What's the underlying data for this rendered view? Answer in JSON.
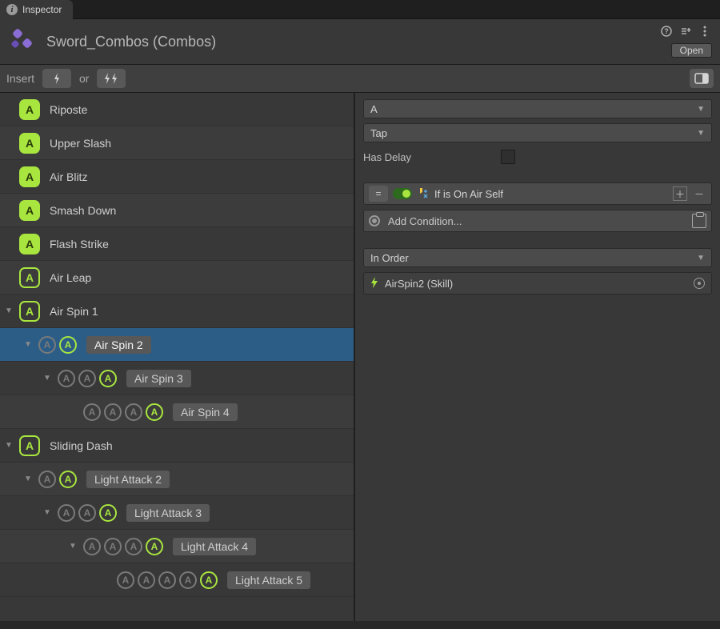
{
  "tab": {
    "title": "Inspector"
  },
  "header": {
    "title": "Sword_Combos (Combos)",
    "open_label": "Open"
  },
  "toolbar": {
    "insert_label": "Insert",
    "or_label": "or"
  },
  "tree": {
    "items": [
      {
        "label": "Riposte",
        "depth": 0,
        "expand": "none",
        "caps": [
          {
            "style": "solid"
          }
        ]
      },
      {
        "label": "Upper Slash",
        "depth": 0,
        "expand": "none",
        "caps": [
          {
            "style": "solid"
          }
        ],
        "alt": true
      },
      {
        "label": "Air Blitz",
        "depth": 0,
        "expand": "none",
        "caps": [
          {
            "style": "solid"
          }
        ]
      },
      {
        "label": "Smash Down",
        "depth": 0,
        "expand": "none",
        "caps": [
          {
            "style": "solid"
          }
        ],
        "alt": true
      },
      {
        "label": "Flash Strike",
        "depth": 0,
        "expand": "none",
        "caps": [
          {
            "style": "solid"
          }
        ]
      },
      {
        "label": "Air Leap",
        "depth": 0,
        "expand": "none",
        "caps": [
          {
            "style": "outline"
          }
        ],
        "alt": true
      },
      {
        "label": "Air Spin 1",
        "depth": 0,
        "expand": "open",
        "caps": [
          {
            "style": "outline"
          }
        ]
      },
      {
        "label": "Air Spin 2",
        "depth": 1,
        "expand": "open",
        "caps": [
          {
            "style": "grey",
            "sm": true
          },
          {
            "style": "outline",
            "sm": true
          }
        ],
        "selected": true,
        "chip": true
      },
      {
        "label": "Air Spin 3",
        "depth": 2,
        "expand": "open",
        "caps": [
          {
            "style": "grey",
            "sm": true
          },
          {
            "style": "grey",
            "sm": true
          },
          {
            "style": "outline",
            "sm": true
          }
        ],
        "chip": true
      },
      {
        "label": "Air Spin 4",
        "depth": 3,
        "expand": "spacer",
        "caps": [
          {
            "style": "grey",
            "sm": true
          },
          {
            "style": "grey",
            "sm": true
          },
          {
            "style": "grey",
            "sm": true
          },
          {
            "style": "outline",
            "sm": true
          }
        ],
        "chip": true,
        "alt": true
      },
      {
        "label": "Sliding Dash",
        "depth": 0,
        "expand": "open",
        "caps": [
          {
            "style": "outline"
          }
        ]
      },
      {
        "label": "Light Attack 2",
        "depth": 1,
        "expand": "open",
        "caps": [
          {
            "style": "grey",
            "sm": true
          },
          {
            "style": "outline",
            "sm": true
          }
        ],
        "chip": true,
        "alt": true
      },
      {
        "label": "Light Attack 3",
        "depth": 2,
        "expand": "open",
        "caps": [
          {
            "style": "grey",
            "sm": true
          },
          {
            "style": "grey",
            "sm": true
          },
          {
            "style": "outline",
            "sm": true
          }
        ],
        "chip": true
      },
      {
        "label": "Light Attack 4",
        "depth": 3,
        "expand": "open",
        "caps": [
          {
            "style": "grey",
            "sm": true
          },
          {
            "style": "grey",
            "sm": true
          },
          {
            "style": "grey",
            "sm": true
          },
          {
            "style": "outline",
            "sm": true
          }
        ],
        "chip": true,
        "alt": true
      },
      {
        "label": "Light Attack 5",
        "depth": 4,
        "expand": "spacer",
        "caps": [
          {
            "style": "grey",
            "sm": true
          },
          {
            "style": "grey",
            "sm": true
          },
          {
            "style": "grey",
            "sm": true
          },
          {
            "style": "grey",
            "sm": true
          },
          {
            "style": "outline",
            "sm": true
          }
        ],
        "chip": true
      }
    ],
    "cap_letter": "A"
  },
  "details": {
    "button_dropdown": "A",
    "press_dropdown": "Tap",
    "has_delay_label": "Has Delay",
    "has_delay_value": false,
    "condition_text": "If is On Air Self",
    "add_condition_label": "Add Condition...",
    "order_dropdown": "In Order",
    "skill_ref": "AirSpin2 (Skill)"
  }
}
